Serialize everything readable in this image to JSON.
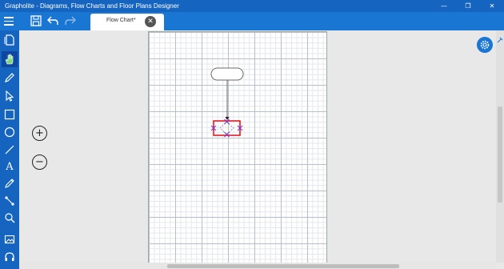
{
  "window": {
    "title": "Grapholite - Diagrams, Flow Charts and Floor Plans Designer",
    "minimize_glyph": "—",
    "maximize_glyph": "❐",
    "close_glyph": "✕"
  },
  "toolbar": {
    "icons": [
      "menu-icon",
      "save-icon",
      "undo-icon",
      "redo-icon"
    ]
  },
  "tab": {
    "label": "Flow Chart*",
    "close_glyph": "✕"
  },
  "sidebar": {
    "tools": [
      "new-document-icon",
      "pan-hand-icon",
      "pen-icon",
      "select-pointer-icon",
      "rectangle-icon",
      "ellipse-icon",
      "line-icon",
      "text-icon",
      "pencil-icon",
      "connector-icon",
      "zoom-icon",
      "image-icon",
      "headset-icon"
    ],
    "active_tool": "pan-hand-icon",
    "text_tool_glyph": "A"
  },
  "zoom": {
    "zoom_in_glyph": "+",
    "zoom_out_glyph": "−"
  },
  "colors": {
    "titlebar": "#1565c0",
    "toolbar": "#1976d2",
    "selection": "#e01b24",
    "handles": "#7b2fd0"
  }
}
